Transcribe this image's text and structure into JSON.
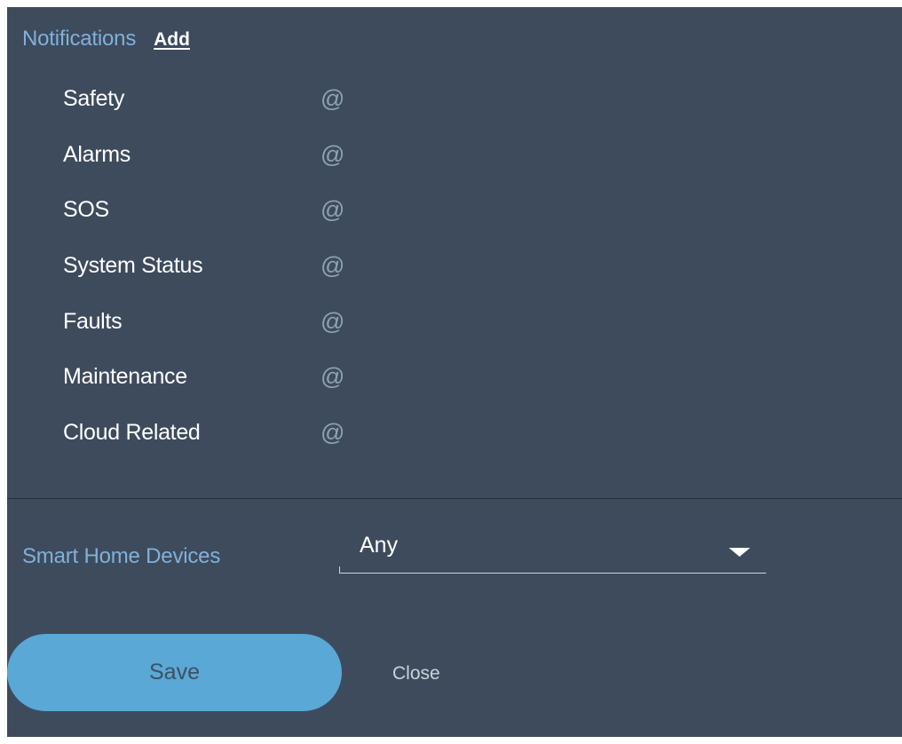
{
  "notifications": {
    "title": "Notifications",
    "add_label": "Add",
    "items": [
      {
        "label": "Safety",
        "icon": "@"
      },
      {
        "label": "Alarms",
        "icon": "@"
      },
      {
        "label": "SOS",
        "icon": "@"
      },
      {
        "label": "System Status",
        "icon": "@"
      },
      {
        "label": "Faults",
        "icon": "@"
      },
      {
        "label": "Maintenance",
        "icon": "@"
      },
      {
        "label": "Cloud Related",
        "icon": "@"
      }
    ]
  },
  "smart_home": {
    "label": "Smart Home Devices",
    "selected": "Any"
  },
  "actions": {
    "save_label": "Save",
    "close_label": "Close"
  },
  "colors": {
    "panel_bg": "#3e4b5d",
    "accent_label": "#7fb1da",
    "save_button": "#5aa8d6",
    "at_icon": "#8ea2b5"
  }
}
